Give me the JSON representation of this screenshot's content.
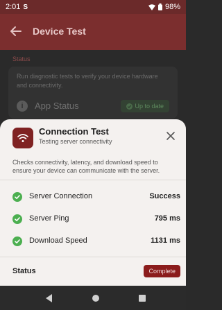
{
  "status_bar": {
    "time": "2:01",
    "notification_glyph": "S",
    "battery": "98%"
  },
  "app_bar": {
    "title": "Device Test"
  },
  "background": {
    "section_label": "Status",
    "card_description": "Run diagnostic tests to verify your device hardware and connectivity.",
    "app_status_label": "App Status",
    "app_status_badge": "Up to date"
  },
  "sheet": {
    "title": "Connection Test",
    "subtitle": "Testing server connectivity",
    "description": "Checks connectivity, latency, and download speed to ensure your device can communicate with the server.",
    "checks": [
      {
        "label": "Server Connection",
        "value": "Success"
      },
      {
        "label": "Server Ping",
        "value": "795 ms"
      },
      {
        "label": "Download Speed",
        "value": "1131 ms"
      }
    ],
    "status_label": "Status",
    "status_badge": "Complete"
  },
  "colors": {
    "accent": "#7b2e2e",
    "success": "#4caf50",
    "badge": "#8b1c1c"
  }
}
